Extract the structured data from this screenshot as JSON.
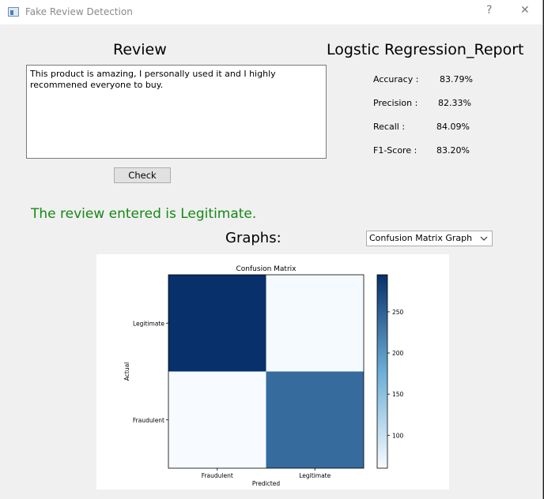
{
  "window": {
    "title": "Fake Review Detection",
    "help_label": "?",
    "close_label": "✕"
  },
  "review": {
    "heading": "Review",
    "text": "This product is amazing, I personally used it and I highly recommened everyone to buy.",
    "check_label": "Check"
  },
  "report": {
    "heading": "Logstic Regression_Report",
    "metrics": [
      {
        "label": "Accuracy :",
        "value": "83.79%"
      },
      {
        "label": "Precision :",
        "value": "82.33%"
      },
      {
        "label": "Recall :",
        "value": "84.09%"
      },
      {
        "label": "F1-Score :",
        "value": "83.20%"
      }
    ]
  },
  "result": {
    "text": "The review entered is Legitimate."
  },
  "graphs": {
    "label": "Graphs:",
    "selected": "Confusion Matrix Graph",
    "dropdown_icon": "chevron-down-icon"
  },
  "chart_data": {
    "type": "heatmap",
    "title": "Confusion Matrix",
    "xlabel": "Predicted",
    "ylabel": "Actual",
    "x_categories": [
      "Fraudulent",
      "Legitimate"
    ],
    "y_categories": [
      "Legitimate",
      "Fraudulent"
    ],
    "values": [
      [
        295,
        62
      ],
      [
        60,
        240
      ]
    ],
    "colorbar_ticks": [
      100,
      150,
      200,
      250
    ],
    "colorbar_range": [
      60,
      295
    ],
    "colormap": "Blues",
    "colors": {
      "low": "#f7fbff",
      "high": "#08306b"
    }
  }
}
